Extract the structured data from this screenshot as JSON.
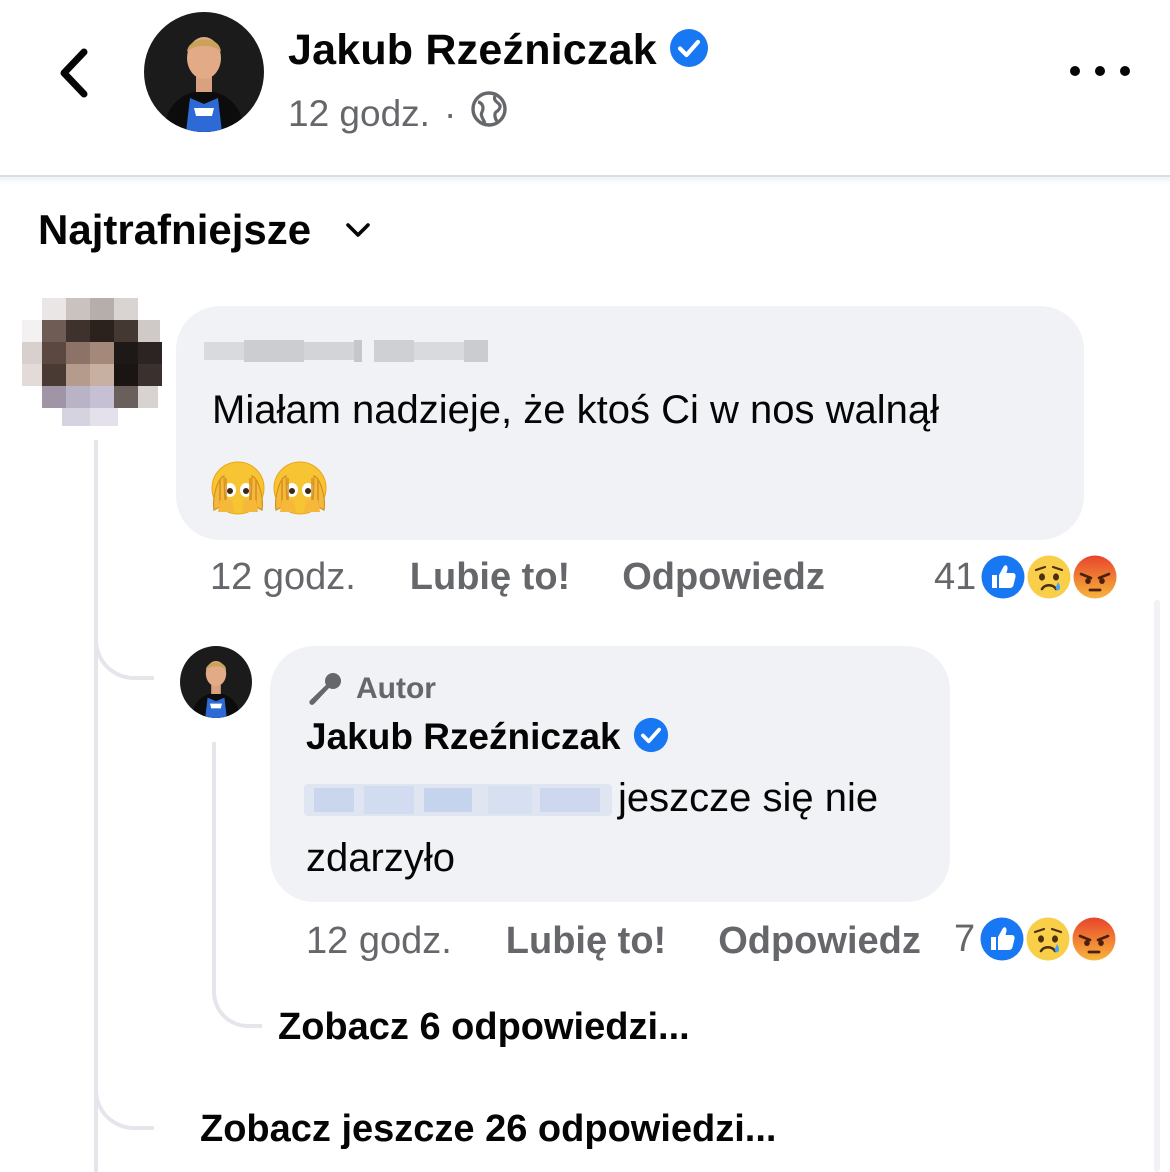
{
  "header": {
    "name": "Jakub Rzeźniczak",
    "time": "12 godz.",
    "dot": "·",
    "verified": true,
    "icons": [
      "back-icon",
      "verified-icon",
      "globe-icon",
      "more-icon"
    ]
  },
  "sort": {
    "label": "Najtrafniejsze",
    "icon": "chevron-down-icon"
  },
  "comments": [
    {
      "author_blurred": true,
      "text": "Miałam nadzieje, że ktoś Ci w nos walnął",
      "emoji": [
        "🫣",
        "🫣"
      ],
      "time": "12 godz.",
      "like_label": "Lubię to!",
      "reply_label": "Odpowiedz",
      "reaction_count": "41",
      "reactions": [
        "like",
        "sad",
        "angry"
      ],
      "replies": [
        {
          "badge": "Autor",
          "author": "Jakub Rzeźniczak",
          "verified": true,
          "mention_blurred": true,
          "text_line1": "jeszcze się nie",
          "text_line2": "zdarzyło",
          "time": "12 godz.",
          "like_label": "Lubię to!",
          "reply_label": "Odpowiedz",
          "reaction_count": "7",
          "reactions": [
            "like",
            "sad",
            "angry"
          ],
          "see_more": "Zobacz 6 odpowiedzi..."
        }
      ],
      "see_more": "Zobacz jeszcze 26 odpowiedzi..."
    }
  ],
  "colors": {
    "text": "#050505",
    "secondary": "#65676b",
    "bubble": "#f0f2f5",
    "verified": "#1877f2",
    "like": "#1877f2",
    "angry": "#e9710f"
  }
}
